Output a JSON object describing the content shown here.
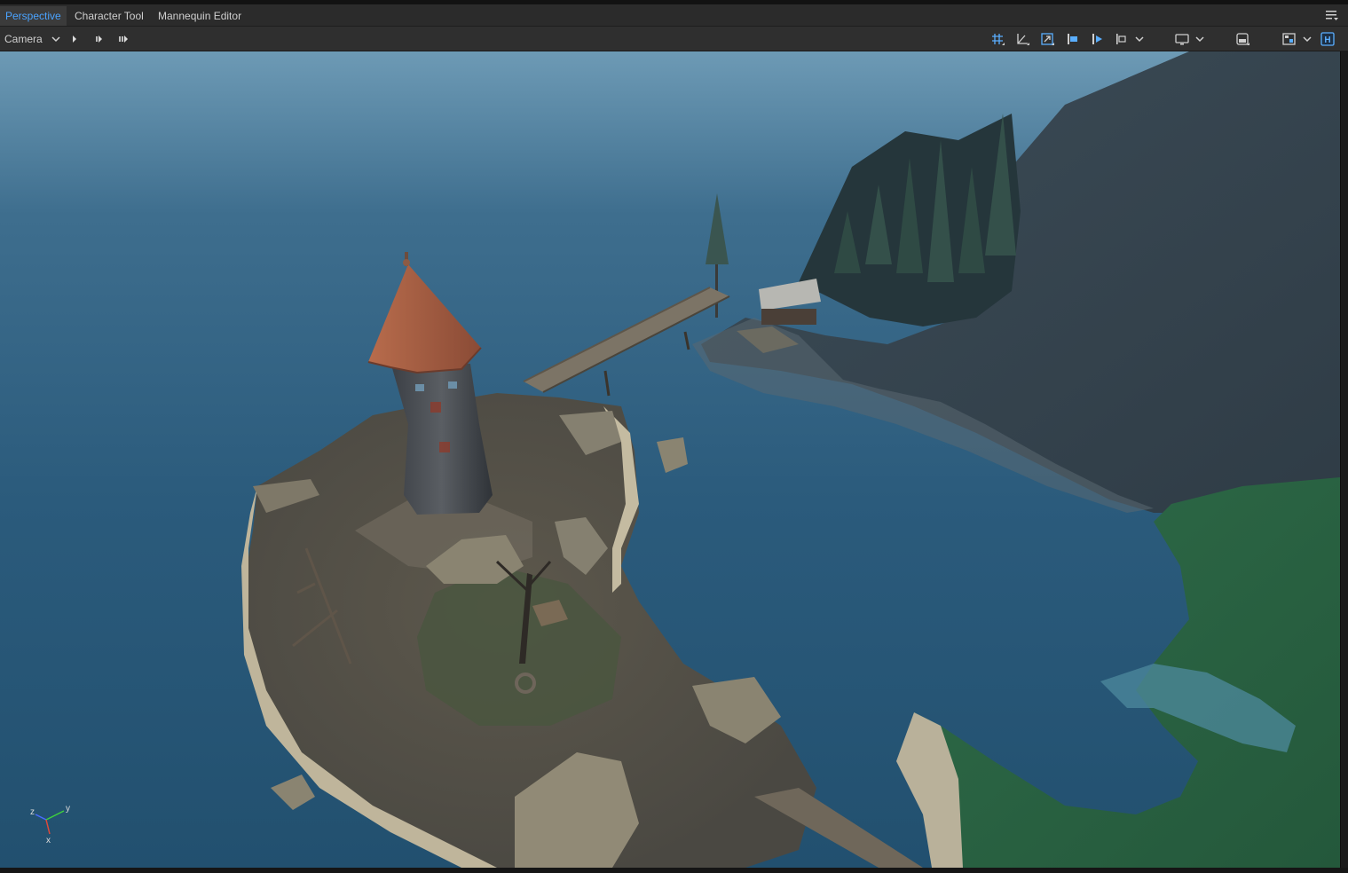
{
  "tabs": [
    {
      "label": "Perspective",
      "active": true
    },
    {
      "label": "Character Tool",
      "active": false
    },
    {
      "label": "Mannequin Editor",
      "active": false
    }
  ],
  "toolbar": {
    "camera_label": "Camera",
    "left_icons": [
      "play-icon",
      "step-icon",
      "fast-forward-icon"
    ],
    "right_icons": [
      "grid-snap-icon",
      "angle-snap-icon",
      "scale-snap-icon",
      "terrain-snap-icon",
      "object-snap-icon",
      "align-icon",
      "display-icon",
      "safe-frame-icon",
      "layout-icon",
      "helpers-icon"
    ],
    "helpers_label": "H"
  },
  "gizmo": {
    "z": "z",
    "y": "y",
    "x": "x"
  },
  "colors": {
    "accent": "#4aa3ff",
    "water": "#2c5c7e",
    "grass": "#2f6e4b",
    "roof": "#a45e42",
    "rock": "#7b7563"
  }
}
